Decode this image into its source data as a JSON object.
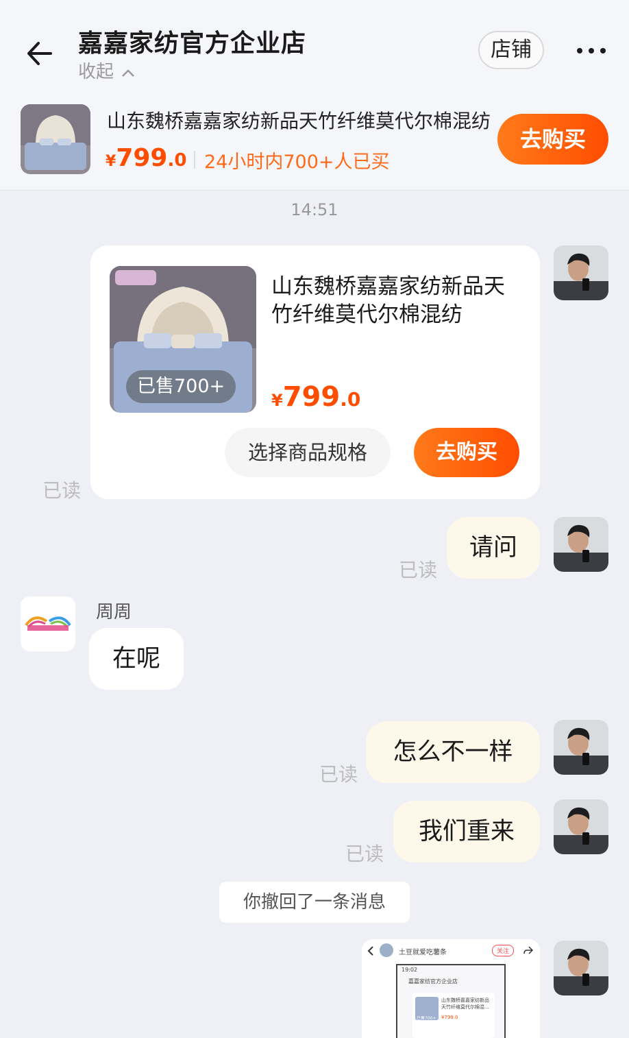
{
  "header": {
    "shop_name": "嘉嘉家纺官方企业店",
    "collapse_label": "收起",
    "store_button": "店铺"
  },
  "product_bar": {
    "title": "山东魏桥嘉嘉家纺新品天竹纤维莫代尔棉混纺",
    "price_symbol": "¥",
    "price_int": "799",
    "price_dec": ".0",
    "sold_text": "24小时内700+人已买",
    "buy_button": "去购买"
  },
  "chat": {
    "timestamp": "14:51",
    "product_card": {
      "title": "山东魏桥嘉嘉家纺新品天竹纤维莫代尔棉混纺",
      "badge": "已售700+",
      "price_symbol": "¥",
      "price_int": "799",
      "price_dec": ".0",
      "spec_button": "选择商品规格",
      "buy_button": "去购买",
      "read_status": "已读"
    },
    "messages": [
      {
        "from": "me",
        "text": "请问",
        "read_status": "已读"
      },
      {
        "from": "shop",
        "sender": "周周",
        "text": "在呢"
      },
      {
        "from": "me",
        "text": "怎么不一样",
        "read_status": "已读"
      },
      {
        "from": "me",
        "text": "我们重来",
        "read_status": "已读"
      }
    ],
    "recall_notice": "你撤回了一条消息",
    "screenshot_preview": {
      "title": "土豆就爱吃薯条",
      "follow": "关注",
      "inner_time": "19:02",
      "inner_shop": "嘉嘉家纺官方企业店",
      "inner_product": "山东魏桥嘉嘉家纺新品",
      "inner_product_2": "天竹纤维莫代尔棉混...",
      "inner_price": "¥799.0",
      "inner_badge": "已售700+"
    }
  },
  "colors": {
    "accent": "#ff4d00",
    "bubble_me": "#fdf8e9",
    "background": "#eef0f5"
  },
  "icons": [
    "back-arrow-icon",
    "chevron-up-icon",
    "more-dots-icon"
  ]
}
